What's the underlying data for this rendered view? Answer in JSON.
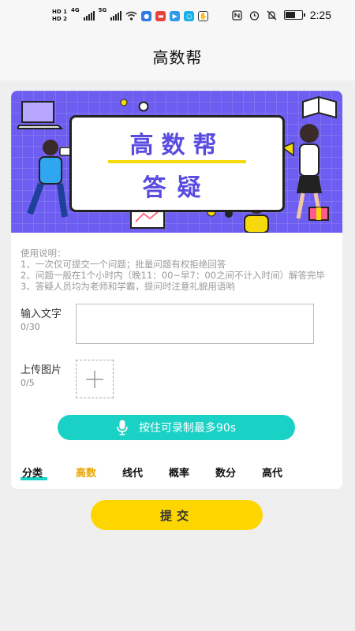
{
  "status_bar": {
    "hd1": "HD 1",
    "hd2": "HD 2",
    "net1": "4G",
    "net2": "5G",
    "time": "2:25",
    "battery_level": 0.55,
    "icons": [
      "signal-icon",
      "wifi-icon",
      "nfc-icon",
      "alarm-icon",
      "mute-icon",
      "battery-icon"
    ]
  },
  "title": "高数帮",
  "banner": {
    "title": "高数帮",
    "subtitle": "答疑",
    "colors": {
      "background": "#6d5df0",
      "text": "#5a4be0",
      "accent": "#f5d90a"
    }
  },
  "instructions": {
    "heading": "使用说明：",
    "lines": [
      "1、一次仅可提交一个问题；批量问题有权拒绝回答",
      "2、问题一般在1个小时内（晚11：00~早7：00之间不计入时间）解答完毕",
      "3、答疑人员均为老师和学霸，提问时注意礼貌用语哟"
    ]
  },
  "text_input": {
    "label": "输入文字",
    "count": "0/30",
    "value": "",
    "placeholder": ""
  },
  "image_upload": {
    "label": "上传图片",
    "count": "0/5"
  },
  "record_button": {
    "label": "按住可录制最多90s",
    "color": "#19d1c4"
  },
  "category": {
    "heading": "分类",
    "tabs": [
      "高数",
      "线代",
      "概率",
      "数分",
      "高代"
    ],
    "selected": "高数",
    "selected_color": "#e8a400"
  },
  "submit_button": {
    "label": "提交",
    "color": "#fdd600"
  }
}
